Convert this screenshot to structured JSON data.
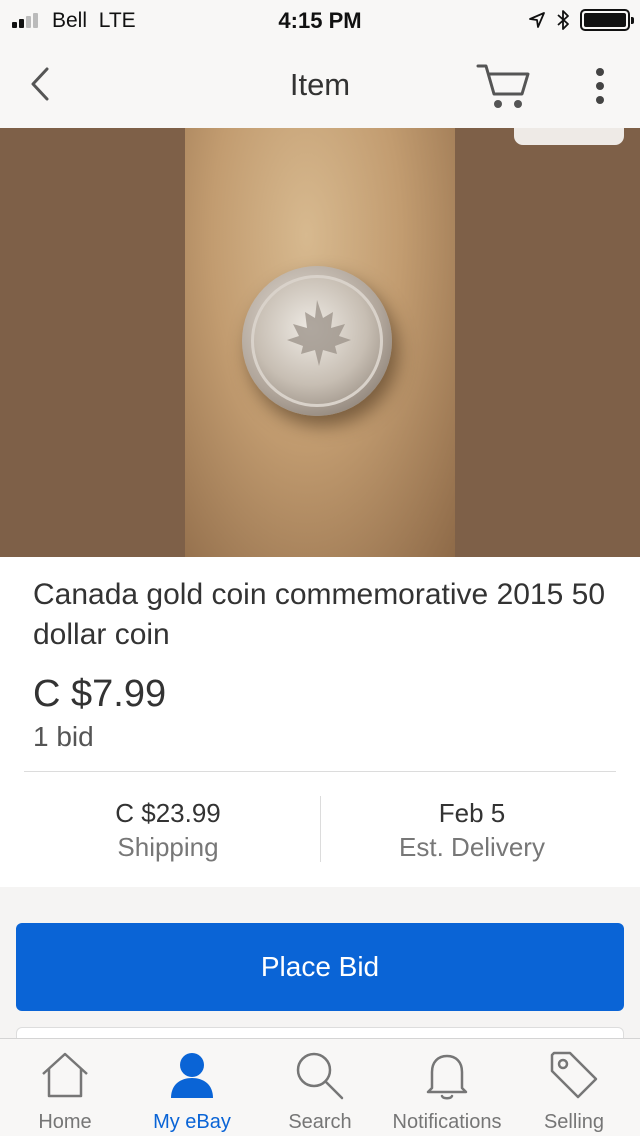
{
  "status_bar": {
    "carrier": "Bell",
    "network": "LTE",
    "time": "4:15 PM",
    "signal_bars": 4,
    "signal_bars_filled": 2
  },
  "header": {
    "title": "Item",
    "icons": [
      "chevron-left-icon",
      "cart-icon",
      "more-vertical-icon"
    ]
  },
  "item": {
    "title": "Canada gold coin commemorative 2015 50 dollar coin",
    "price": "C $7.99",
    "bids": "1 bid",
    "shipping_value": "C $23.99",
    "shipping_label": "Shipping",
    "delivery_value": "Feb 5",
    "delivery_label": "Est. Delivery"
  },
  "actions": {
    "place_bid": "Place Bid"
  },
  "tabbar": {
    "tabs": [
      {
        "label": "Home",
        "icon": "home-icon"
      },
      {
        "label": "My eBay",
        "icon": "person-icon"
      },
      {
        "label": "Search",
        "icon": "search-icon"
      },
      {
        "label": "Notifications",
        "icon": "bell-icon"
      },
      {
        "label": "Selling",
        "icon": "tag-icon"
      }
    ],
    "active": "My eBay"
  },
  "colors": {
    "accent": "#0a64d6",
    "photo_bg": "#7e6048",
    "tab_inactive": "#767676"
  }
}
